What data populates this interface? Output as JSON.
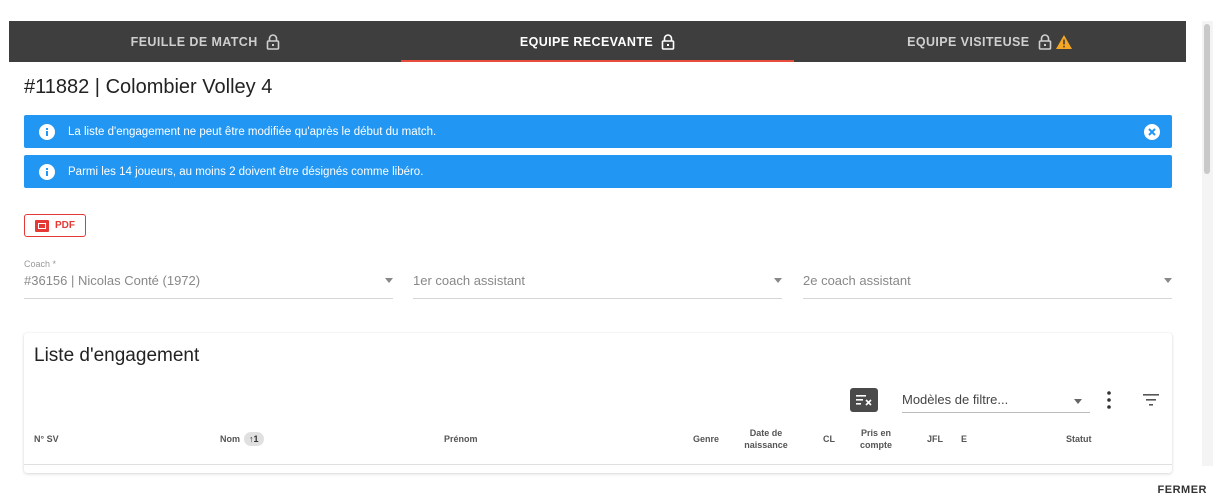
{
  "tabs": [
    {
      "label": "FEUILLE DE MATCH",
      "active": false,
      "icon": "lock-icon"
    },
    {
      "label": "EQUIPE RECEVANTE",
      "active": true,
      "icon": "lock-icon"
    },
    {
      "label": "EQUIPE VISITEUSE",
      "active": false,
      "icon": "lock-icon",
      "warning": "warning-icon"
    }
  ],
  "page": {
    "title": "#11882 | Colombier Volley 4"
  },
  "alerts": [
    {
      "text": "La liste d'engagement ne peut être modifiée qu'après le début du match.",
      "closable": true
    },
    {
      "text": "Parmi les 14 joueurs, au moins 2 doivent être désignés comme libéro.",
      "closable": false
    }
  ],
  "pdf_button": {
    "label": "PDF"
  },
  "coaches": {
    "coach": {
      "label": "Coach *",
      "value": "#36156 | Nicolas Conté (1972)"
    },
    "assistant1": {
      "placeholder": "1er coach assistant"
    },
    "assistant2": {
      "placeholder": "2e coach assistant"
    }
  },
  "engagement": {
    "title": "Liste d'engagement",
    "filter_model_placeholder": "Modèles de filtre...",
    "columns": {
      "nsv": "N° SV",
      "nom": "Nom",
      "nom_sort": "1",
      "prenom": "Prénom",
      "genre": "Genre",
      "date_naissance_1": "Date de",
      "date_naissance_2": "naissance",
      "cl": "CL",
      "pris_1": "Pris en",
      "pris_2": "compte",
      "jfl": "JFL",
      "e": "E",
      "statut": "Statut"
    }
  },
  "footer": {
    "close_label": "FERMER"
  },
  "colors": {
    "tab_bar": "#3e3e3e",
    "alert": "#2196f3",
    "accent": "#e53935",
    "warning": "#f5a623"
  }
}
